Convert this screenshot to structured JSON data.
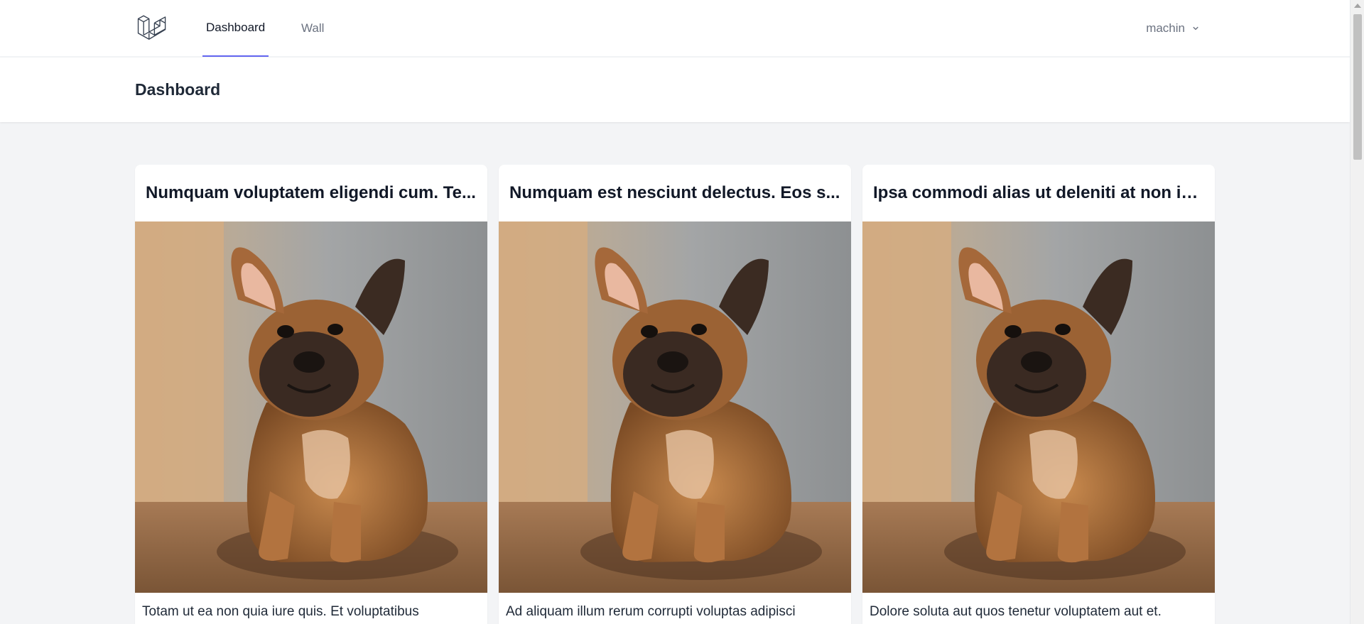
{
  "nav": {
    "logo_icon": "laravel-logo-icon",
    "links": [
      {
        "label": "Dashboard",
        "active": true
      },
      {
        "label": "Wall",
        "active": false
      }
    ],
    "user_name": "machin",
    "user_menu_icon": "chevron-down-icon"
  },
  "header": {
    "title": "Dashboard"
  },
  "posts": [
    {
      "title": "Numquam voluptatem eligendi cum. Te...",
      "image": "french-bulldog-photo",
      "excerpt": "Totam ut ea non quia iure quis. Et voluptatibus"
    },
    {
      "title": "Numquam est nesciunt delectus. Eos s...",
      "image": "french-bulldog-photo",
      "excerpt": "Ad aliquam illum rerum corrupti voluptas adipisci"
    },
    {
      "title": "Ipsa commodi alias ut deleniti at non ip...",
      "image": "french-bulldog-photo",
      "excerpt": "Dolore soluta aut quos tenetur voluptatem aut et."
    }
  ],
  "colors": {
    "accent": "#6366f1",
    "background": "#f3f4f6",
    "card": "#ffffff"
  }
}
